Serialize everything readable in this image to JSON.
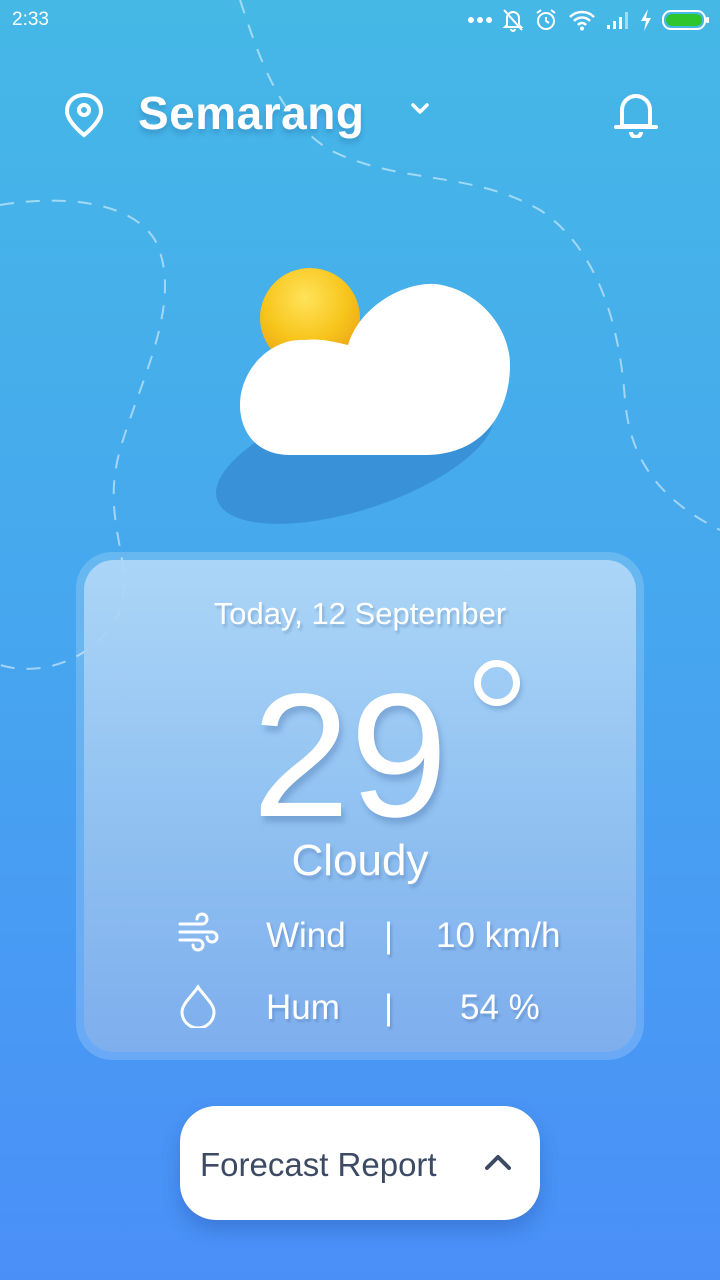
{
  "status_bar": {
    "time": "2:33",
    "icons": [
      "more-dots-icon",
      "bell-muted-icon",
      "alarm-icon",
      "wifi-icon",
      "signal-icon",
      "charging-icon",
      "battery-icon"
    ],
    "battery_color": "#2ec52e"
  },
  "header": {
    "city": "Semarang",
    "icons": [
      "location-pin-icon",
      "chevron-down-icon",
      "notification-bell-icon"
    ]
  },
  "weather": {
    "illustration": "sun-behind-cloud-icon",
    "date": "Today, 12 September",
    "temperature": "29",
    "condition": "Cloudy",
    "wind": {
      "label": "Wind",
      "separator": "|",
      "value": "10 km/h",
      "icon": "wind-icon"
    },
    "humidity": {
      "label": "Hum",
      "separator": "|",
      "value": "54 %",
      "icon": "droplet-icon"
    }
  },
  "forecast_button": {
    "label": "Forecast Report",
    "icon": "chevron-up-icon"
  },
  "colors": {
    "background_top": "#45b8e6",
    "background_bottom": "#4a8ff8",
    "sun": "#f7c51c",
    "button_text": "#3c4a63"
  }
}
